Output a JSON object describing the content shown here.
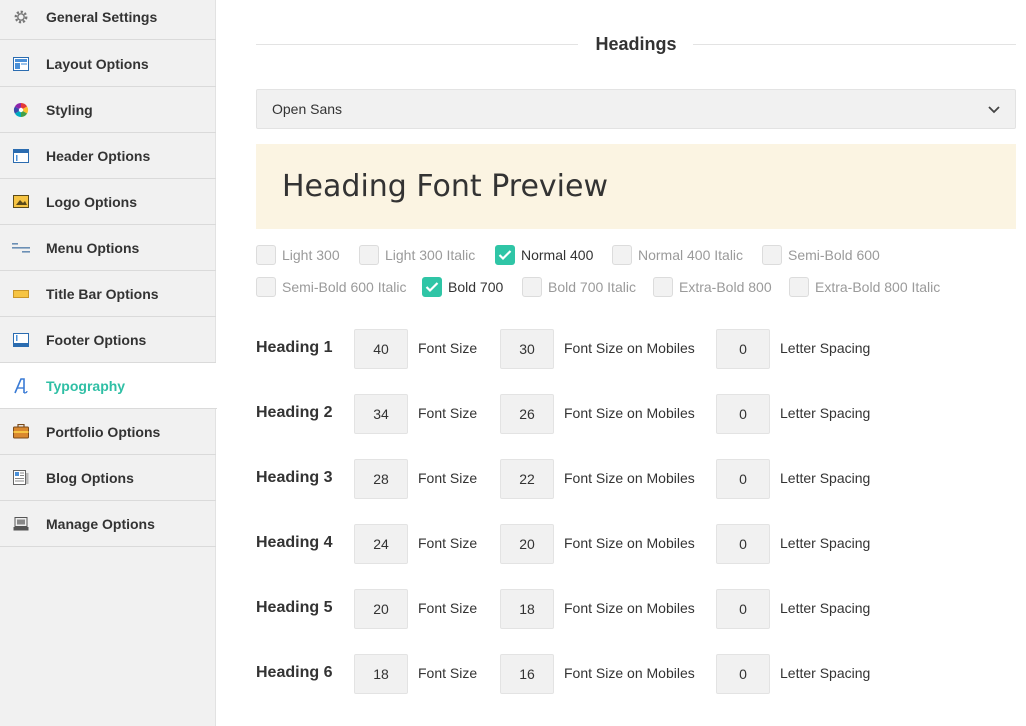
{
  "sidebar": {
    "items": [
      {
        "label": "General Settings",
        "icon": "gear-icon"
      },
      {
        "label": "Layout Options",
        "icon": "layout-icon"
      },
      {
        "label": "Styling",
        "icon": "color-wheel-icon"
      },
      {
        "label": "Header Options",
        "icon": "header-icon"
      },
      {
        "label": "Logo Options",
        "icon": "logo-image-icon"
      },
      {
        "label": "Menu Options",
        "icon": "menu-icon"
      },
      {
        "label": "Title Bar Options",
        "icon": "title-bar-icon"
      },
      {
        "label": "Footer Options",
        "icon": "footer-icon"
      },
      {
        "label": "Typography",
        "icon": "typography-icon",
        "active": true
      },
      {
        "label": "Portfolio Options",
        "icon": "portfolio-icon"
      },
      {
        "label": "Blog Options",
        "icon": "blog-icon"
      },
      {
        "label": "Manage Options",
        "icon": "manage-icon"
      }
    ],
    "active_color": "#2fbfa5"
  },
  "main": {
    "section_title": "Headings",
    "font_select": {
      "value": "Open Sans"
    },
    "preview_text": "Heading Font Preview",
    "preview_bg": "#fbf4e2",
    "weights_row1": [
      {
        "label": "Light 300",
        "checked": false
      },
      {
        "label": "Light 300 Italic",
        "checked": false
      },
      {
        "label": "Normal 400",
        "checked": true
      },
      {
        "label": "Normal 400 Italic",
        "checked": false
      },
      {
        "label": "Semi-Bold 600",
        "checked": false
      }
    ],
    "weights_row2": [
      {
        "label": "Semi-Bold 600 Italic",
        "checked": false
      },
      {
        "label": "Bold 700",
        "checked": true
      },
      {
        "label": "Bold 700 Italic",
        "checked": false
      },
      {
        "label": "Extra-Bold 800",
        "checked": false
      },
      {
        "label": "Extra-Bold 800 Italic",
        "checked": false
      }
    ],
    "field_labels": {
      "font_size": "Font Size",
      "font_size_mobile": "Font Size on Mobiles",
      "letter_spacing": "Letter Spacing"
    },
    "headings": [
      {
        "name": "Heading 1",
        "font_size": "40",
        "mobile": "30",
        "spacing": "0"
      },
      {
        "name": "Heading 2",
        "font_size": "34",
        "mobile": "26",
        "spacing": "0"
      },
      {
        "name": "Heading 3",
        "font_size": "28",
        "mobile": "22",
        "spacing": "0"
      },
      {
        "name": "Heading 4",
        "font_size": "24",
        "mobile": "20",
        "spacing": "0"
      },
      {
        "name": "Heading 5",
        "font_size": "20",
        "mobile": "18",
        "spacing": "0"
      },
      {
        "name": "Heading 6",
        "font_size": "18",
        "mobile": "16",
        "spacing": "0"
      }
    ],
    "checkbox_color": "#2fc5a6"
  }
}
